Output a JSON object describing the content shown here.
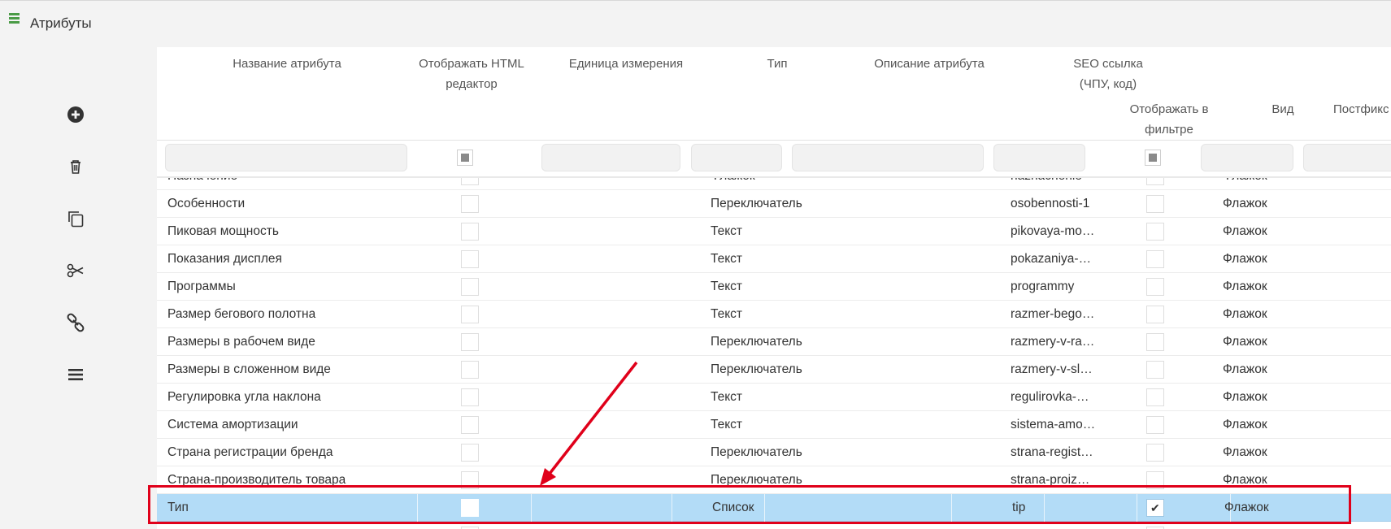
{
  "app": {
    "title": "Атрибуты"
  },
  "toolbar": {
    "tools": [
      {
        "name": "add-button",
        "icon": "plus-circle-icon"
      },
      {
        "name": "delete-button",
        "icon": "trash-icon"
      },
      {
        "name": "copy-button",
        "icon": "copy-icon"
      },
      {
        "name": "cut-button",
        "icon": "scissors-icon"
      },
      {
        "name": "link-button",
        "icon": "link-icon"
      },
      {
        "name": "menu-button",
        "icon": "hamburger-icon"
      }
    ]
  },
  "grid": {
    "columns": {
      "name": "Название атрибута",
      "html_editor_1": "Отображать HTML",
      "html_editor_2": "редактор",
      "unit": "Единица измерения",
      "type": "Тип",
      "description": "Описание атрибута",
      "seo_1": "SEO ссылка",
      "seo_2": "(ЧПУ, код)",
      "show_filter_1": "Отображать в",
      "show_filter_2": "фильтре",
      "view": "Вид",
      "postfix": "Постфикс для"
    },
    "rows": [
      {
        "name": "Назначение",
        "type": "Флажок",
        "seo": "naznachenie",
        "view": "Флажок"
      },
      {
        "name": "Особенности",
        "type": "Переключатель",
        "seo": "osobennosti-1",
        "view": "Флажок"
      },
      {
        "name": "Пиковая мощность",
        "type": "Текст",
        "seo": "pikovaya-moshchnost",
        "view": "Флажок"
      },
      {
        "name": "Показания дисплея",
        "type": "Текст",
        "seo": "pokazaniya-displeya",
        "view": "Флажок"
      },
      {
        "name": "Программы",
        "type": "Текст",
        "seo": "programmy",
        "view": "Флажок"
      },
      {
        "name": "Размер бегового полотна",
        "type": "Текст",
        "seo": "razmer-begovogo-polotna",
        "view": "Флажок"
      },
      {
        "name": "Размеры в рабочем виде",
        "type": "Переключатель",
        "seo": "razmery-v-rabochem-vide",
        "view": "Флажок"
      },
      {
        "name": "Размеры в сложенном виде",
        "type": "Переключатель",
        "seo": "razmery-v-slozhennom-vide",
        "view": "Флажок"
      },
      {
        "name": "Регулировка угла наклона",
        "type": "Текст",
        "seo": "regulirovka-ugla-naklona",
        "view": "Флажок"
      },
      {
        "name": "Система амортизации",
        "type": "Текст",
        "seo": "sistema-amortizatsii",
        "view": "Флажок"
      },
      {
        "name": "Страна регистрации бренда",
        "type": "Переключатель",
        "seo": "strana-registratsii-brenda",
        "view": "Флажок"
      },
      {
        "name": "Страна-производитель товара",
        "type": "Переключатель",
        "seo": "strana-proizvoditel-tovara",
        "view": "Флажок"
      },
      {
        "name": "Тип",
        "type": "Список",
        "seo": "tip",
        "view": "Флажок",
        "selected": true,
        "show_in_filter": true
      },
      {
        "name": "",
        "type": "",
        "seo": "",
        "view": ""
      }
    ]
  },
  "annotation": {
    "color": "#e0001a"
  },
  "colors": {
    "selected_row": "#b3dcf7",
    "sidebar_bg": "#f3f3f3",
    "accent_icon": "#4a9b46"
  }
}
